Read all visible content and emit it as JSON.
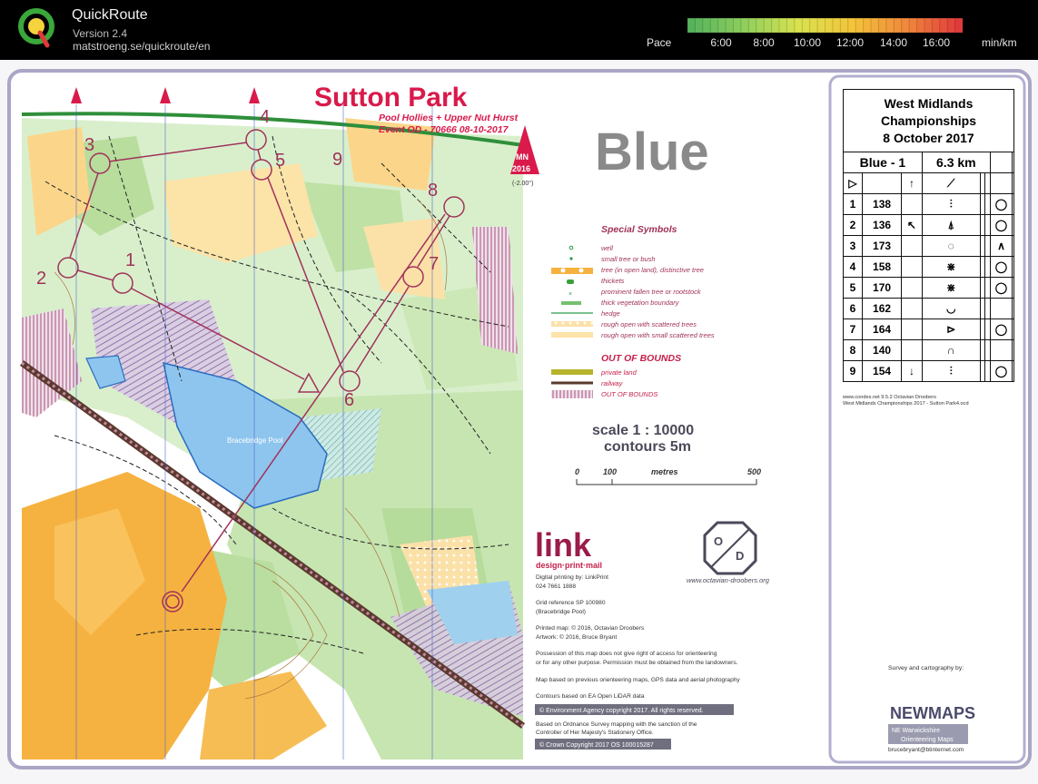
{
  "app": {
    "title": "QuickRoute",
    "version": "Version 2.4",
    "url": "matstroeng.se/quickroute/en"
  },
  "pace_scale": {
    "label": "Pace",
    "ticks": [
      "6:00",
      "8:00",
      "10:00",
      "12:00",
      "14:00",
      "16:00"
    ],
    "unit": "min/km",
    "colors": [
      "#56b35c",
      "#8fcf5d",
      "#d9e24f",
      "#f3c53a",
      "#f08a3c",
      "#e03a3a"
    ]
  },
  "map": {
    "title": "Sutton Park",
    "subtitle": "Pool Hollies + Upper Nut Hurst",
    "event": "Event OD - 70666  08-10-2017",
    "north_label": "MN",
    "north_year": "2016",
    "declination": "(-2.00°)",
    "course_name_big": "Blue",
    "water_label": "Bracebridge Pool",
    "control_numbers": [
      "1",
      "2",
      "3",
      "4",
      "5",
      "6",
      "7",
      "8",
      "9"
    ]
  },
  "legend": {
    "special_title": "Special Symbols",
    "special_items": [
      "well",
      "small tree or bush",
      "tree (in open land), distinctive tree",
      "thickets",
      "prominent fallen tree or rootstock",
      "thick vegetation boundary",
      "hedge",
      "rough open with scattered trees",
      "rough open with small scattered trees"
    ],
    "oob_title": "OUT OF BOUNDS",
    "oob_items": [
      "private land",
      "railway",
      "OUT OF BOUNDS"
    ]
  },
  "scale": {
    "line1": "scale 1 : 10000",
    "line2": "contours 5m",
    "ticks": [
      "0",
      "100",
      "metres",
      "500"
    ]
  },
  "credits": {
    "link_logo": "link",
    "link_tagline": "design·print·mail",
    "printing": "Digital printing by: LinkPrint",
    "phone": "024 7661 1888",
    "grid_ref": "Grid reference SP 100980",
    "grid_place": "(Bracebridge Pool)",
    "printed_map": "Printed map: © 2016, Octavian Droobers",
    "artwork": "Artwork: © 2016, Bruce Bryant",
    "possession1": "Possession of this map does not give right of access for orienteering",
    "possession2": "or for any other purpose. Permission must be obtained from the landowners.",
    "based_on": "Map based on previous orienteering maps, GPS data and aerial photography",
    "contours": "Contours based on EA Open LiDAR data",
    "env_agency": "© Environment Agency copyright 2017. All rights reserved.",
    "os1": "Based on Ordnance Survey mapping with the sanction of the",
    "os2": "Controller of Her Majesty's Stationery Office.",
    "crown": "© Crown Copyright 2017 OS 100015287",
    "od_url": "www.octavian-droobers.org",
    "survey": "Survey and cartography by:",
    "newmaps": "NEWMAPS",
    "nw_line1": "NE Warwickshire",
    "nw_line2": "Orienteering Maps",
    "email": "brucebryant@btinternet.com"
  },
  "control_description": {
    "event_line1": "West Midlands",
    "event_line2": "Championships",
    "event_line3": "8 October 2017",
    "course": "Blue - 1",
    "length": "6.3 km",
    "rows": [
      {
        "num": "1",
        "code": "138"
      },
      {
        "num": "2",
        "code": "136"
      },
      {
        "num": "3",
        "code": "173"
      },
      {
        "num": "4",
        "code": "158"
      },
      {
        "num": "5",
        "code": "170"
      },
      {
        "num": "6",
        "code": "162"
      },
      {
        "num": "7",
        "code": "164"
      },
      {
        "num": "8",
        "code": "140"
      },
      {
        "num": "9",
        "code": "154"
      }
    ],
    "footer1": "www.condes.net 9.5.2 Octavian Droobers",
    "footer2": "West Midlands Championships 2017 - Sutton Park4.ocd"
  }
}
